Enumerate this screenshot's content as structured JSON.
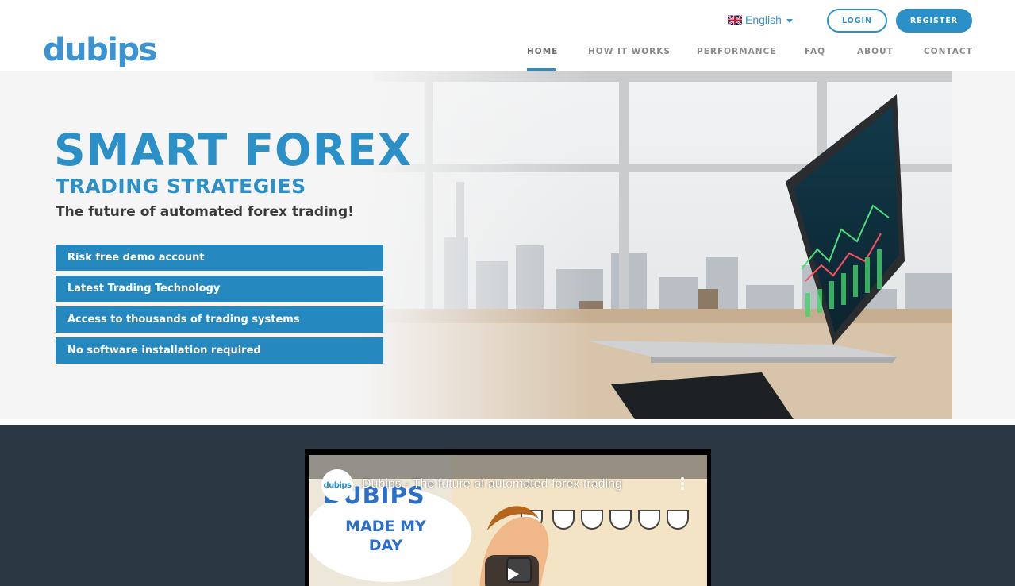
{
  "header": {
    "logo_text": "dubips",
    "language": {
      "label": "English",
      "flag_icon": "uk-flag-icon"
    },
    "login_label": "LOGIN",
    "register_label": "REGISTER",
    "nav": [
      {
        "label": "HOME",
        "active": true
      },
      {
        "label": "HOW IT WORKS",
        "active": false
      },
      {
        "label": "PERFORMANCE",
        "active": false
      },
      {
        "label": "FAQ",
        "active": false
      },
      {
        "label": "ABOUT",
        "active": false
      },
      {
        "label": "CONTACT",
        "active": false
      }
    ]
  },
  "hero": {
    "title": "SMART FOREX",
    "subtitle": "TRADING STRATEGIES",
    "tagline": "The future of automated forex trading!",
    "features": [
      "Risk free demo account",
      "Latest Trading Technology",
      "Access to thousands of trading systems",
      "No software installation required"
    ]
  },
  "video": {
    "channel_avatar_text": "dubips",
    "title": "Dubips - The future of automated forex trading",
    "thumbnail_text_big": "DUBIPS",
    "thumbnail_text": "MADE MY DAY",
    "play_icon": "play-icon",
    "menu_icon": "more-vert-icon"
  },
  "colors": {
    "brand_blue": "#2c90c8",
    "feature_bg": "#2588bf",
    "video_section_bg": "#2c3744",
    "text_dark": "#3a3a3a"
  }
}
